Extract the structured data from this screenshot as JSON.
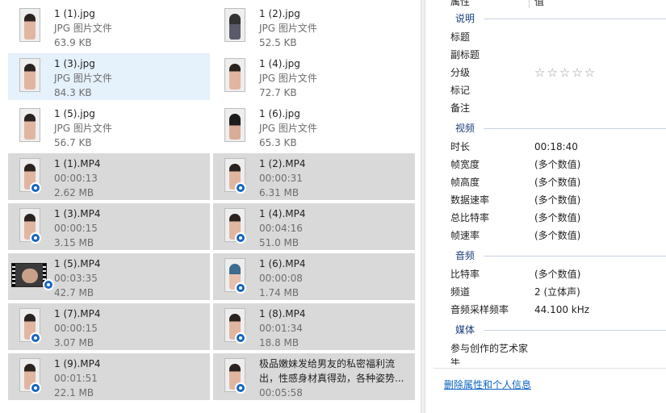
{
  "files": [
    {
      "name": "1 (1).jpg",
      "line2": "JPG 图片文件",
      "line3": "63.9 KB"
    },
    {
      "name": "1 (2).jpg",
      "line2": "JPG 图片文件",
      "line3": "52.5 KB"
    },
    {
      "name": "1 (3).jpg",
      "line2": "JPG 图片文件",
      "line3": "84.3 KB"
    },
    {
      "name": "1 (4).jpg",
      "line2": "JPG 图片文件",
      "line3": "72.7 KB"
    },
    {
      "name": "1 (5).jpg",
      "line2": "JPG 图片文件",
      "line3": "56.7 KB"
    },
    {
      "name": "1 (6).jpg",
      "line2": "JPG 图片文件",
      "line3": "65.3 KB"
    },
    {
      "name": "1 (1).MP4",
      "line2": "00:00:13",
      "line3": "2.62 MB"
    },
    {
      "name": "1 (2).MP4",
      "line2": "00:00:31",
      "line3": "6.31 MB"
    },
    {
      "name": "1 (3).MP4",
      "line2": "00:00:15",
      "line3": "3.15 MB"
    },
    {
      "name": "1 (4).MP4",
      "line2": "00:04:16",
      "line3": "51.0 MB"
    },
    {
      "name": "1 (5).MP4",
      "line2": "00:03:35",
      "line3": "42.7 MB"
    },
    {
      "name": "1 (6).MP4",
      "line2": "00:00:08",
      "line3": "1.74 MB"
    },
    {
      "name": "1 (7).MP4",
      "line2": "00:00:15",
      "line3": "3.07 MB"
    },
    {
      "name": "1 (8).MP4",
      "line2": "00:01:34",
      "line3": "18.8 MB"
    },
    {
      "name": "1 (9).MP4",
      "line2": "00:01:51",
      "line3": "22.1 MB"
    },
    {
      "name": "极品嫩妹发给男友的私密福利流出，性感身材真得劲，各种姿势...",
      "line2": "",
      "line3": "00:05:58"
    }
  ],
  "details": {
    "top_label": "属性",
    "top_value": "值",
    "sections": {
      "description": "说明",
      "video": "视频",
      "audio": "音频",
      "media": "媒体"
    },
    "description": {
      "title": "标题",
      "subtitle": "副标题",
      "rating": "分级",
      "rating_stars": "☆☆☆☆☆",
      "tags": "标记",
      "comments": "备注"
    },
    "video": {
      "duration_label": "时长",
      "duration_value": "00:18:40",
      "frame_width_label": "帧宽度",
      "frame_width_value": "(多个数值)",
      "frame_height_label": "帧高度",
      "frame_height_value": "(多个数值)",
      "data_rate_label": "数据速率",
      "data_rate_value": "(多个数值)",
      "total_bitrate_label": "总比特率",
      "total_bitrate_value": "(多个数值)",
      "frame_rate_label": "帧速率",
      "frame_rate_value": "(多个数值)"
    },
    "audio": {
      "bitrate_label": "比特率",
      "bitrate_value": "(多个数值)",
      "channels_label": "频道",
      "channels_value": "2 (立体声)",
      "sample_rate_label": "音频采样频率",
      "sample_rate_value": "44.100 kHz"
    },
    "media": {
      "contributing_artists_label": "参与创作的艺术家",
      "year_label": "年"
    },
    "remove_link": "删除属性和个人信息"
  }
}
